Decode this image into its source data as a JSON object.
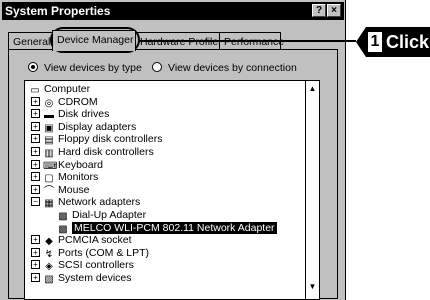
{
  "window": {
    "title": "System Properties",
    "help_btn": "?",
    "close_btn": "×"
  },
  "tabs": [
    {
      "label": "General",
      "active": false
    },
    {
      "label": "Device Manager",
      "active": true
    },
    {
      "label": "Hardware Profiles",
      "active": false
    },
    {
      "label": "Performance",
      "active": false
    }
  ],
  "view_options": {
    "by_type": "View devices by type",
    "by_connection": "View devices by connection",
    "selected": "by_type"
  },
  "device_tree": [
    {
      "label": "Computer",
      "icon": "computer-icon",
      "level": 0,
      "expander": ""
    },
    {
      "label": "CDROM",
      "icon": "cdrom-icon",
      "level": 1,
      "expander": "+"
    },
    {
      "label": "Disk drives",
      "icon": "disk-drive-icon",
      "level": 1,
      "expander": "+"
    },
    {
      "label": "Display adapters",
      "icon": "display-adapter-icon",
      "level": 1,
      "expander": "+"
    },
    {
      "label": "Floppy disk controllers",
      "icon": "floppy-controller-icon",
      "level": 1,
      "expander": "+"
    },
    {
      "label": "Hard disk controllers",
      "icon": "hard-disk-controller-icon",
      "level": 1,
      "expander": "+"
    },
    {
      "label": "Keyboard",
      "icon": "keyboard-icon",
      "level": 1,
      "expander": "+"
    },
    {
      "label": "Monitors",
      "icon": "monitor-icon",
      "level": 1,
      "expander": "+"
    },
    {
      "label": "Mouse",
      "icon": "mouse-icon",
      "level": 1,
      "expander": "+"
    },
    {
      "label": "Network adapters",
      "icon": "network-adapter-icon",
      "level": 1,
      "expander": "−"
    },
    {
      "label": "Dial-Up Adapter",
      "icon": "network-card-icon",
      "level": 2,
      "expander": ""
    },
    {
      "label": "MELCO WLI-PCM 802.11 Network Adapter",
      "icon": "network-card-icon",
      "level": 2,
      "expander": "",
      "selected": true
    },
    {
      "label": "PCMCIA socket",
      "icon": "pcmcia-icon",
      "level": 1,
      "expander": "+"
    },
    {
      "label": "Ports (COM & LPT)",
      "icon": "port-icon",
      "level": 1,
      "expander": "+"
    },
    {
      "label": "SCSI controllers",
      "icon": "scsi-icon",
      "level": 1,
      "expander": "+"
    },
    {
      "label": "System devices",
      "icon": "system-device-icon",
      "level": 1,
      "expander": "+"
    }
  ],
  "scrollbar": {
    "up": "▲",
    "down": "▼"
  },
  "callout": {
    "step": "1",
    "text": "Click"
  }
}
